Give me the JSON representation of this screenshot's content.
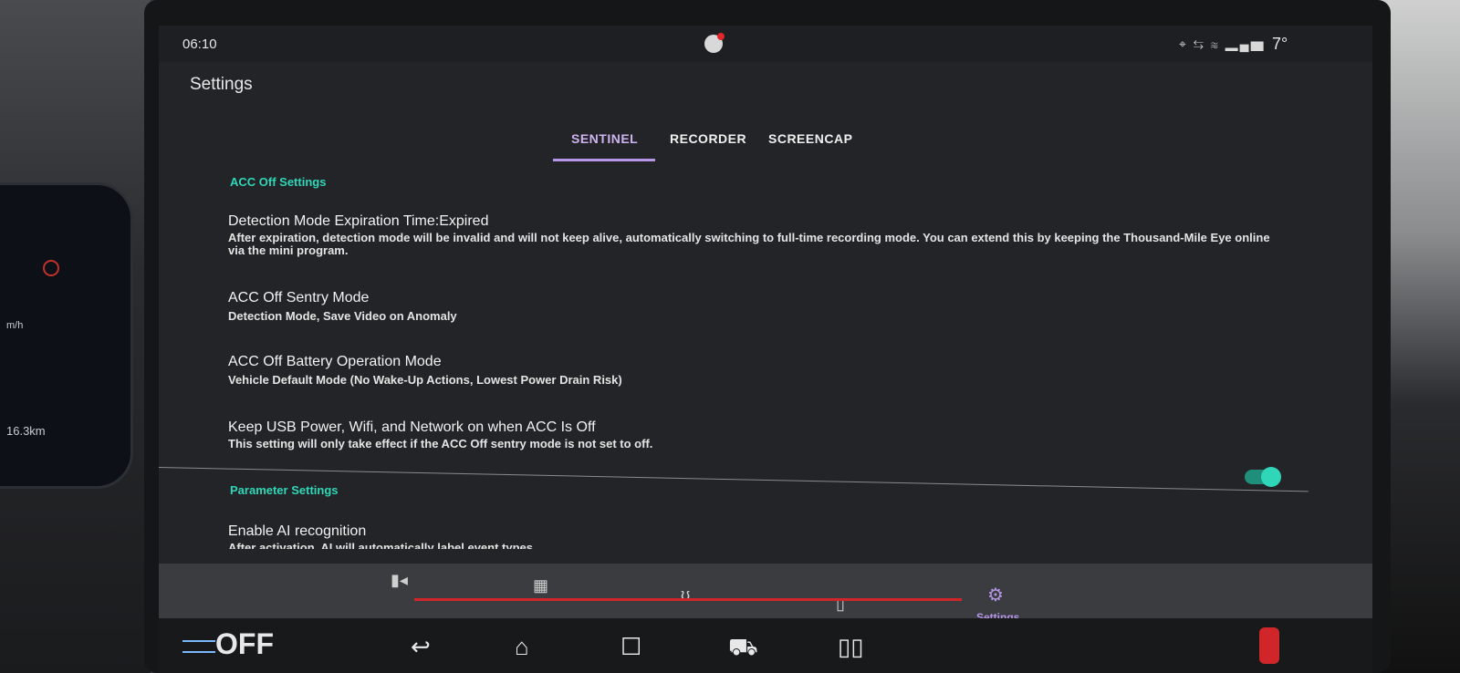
{
  "status": {
    "time": "06:10",
    "temperature": "7°",
    "icons": [
      "location-icon",
      "usb-icon",
      "vibrate-icon",
      "signal-icon",
      "bell-icon"
    ]
  },
  "header": {
    "title": "Settings"
  },
  "tabs": [
    {
      "label": "SENTINEL",
      "active": true
    },
    {
      "label": "RECORDER",
      "active": false
    },
    {
      "label": "SCREENCAP",
      "active": false
    }
  ],
  "sections": {
    "acc_off": "ACC Off Settings",
    "parameter": "Parameter Settings"
  },
  "items": [
    {
      "title": "Detection Mode Expiration Time:Expired",
      "desc": "After expiration, detection mode will be invalid and will not keep alive, automatically switching to full-time recording mode. You can extend this by keeping the Thousand-Mile Eye online via the mini program."
    },
    {
      "title": "ACC Off Sentry Mode",
      "desc": "Detection Mode, Save Video on Anomaly"
    },
    {
      "title": "ACC Off Battery Operation Mode",
      "desc": "Vehicle Default Mode (No Wake-Up Actions, Lowest Power Drain Risk)"
    },
    {
      "title": "Keep USB Power, Wifi, and Network on when ACC Is Off",
      "desc": "This setting will only take effect if the ACC Off sentry mode is not set to off.",
      "toggle": true
    },
    {
      "title": "Enable AI recognition",
      "desc": "After activation, AI will automatically label event types",
      "toggle": false
    }
  ],
  "bottom_nav": {
    "settings_label": "Settings"
  },
  "cluster": {
    "unit": "m/h",
    "odometer": "16.3km"
  },
  "system": {
    "logo": "OFF"
  },
  "colors": {
    "accent": "#b495e6",
    "section": "#2fd6b8"
  }
}
